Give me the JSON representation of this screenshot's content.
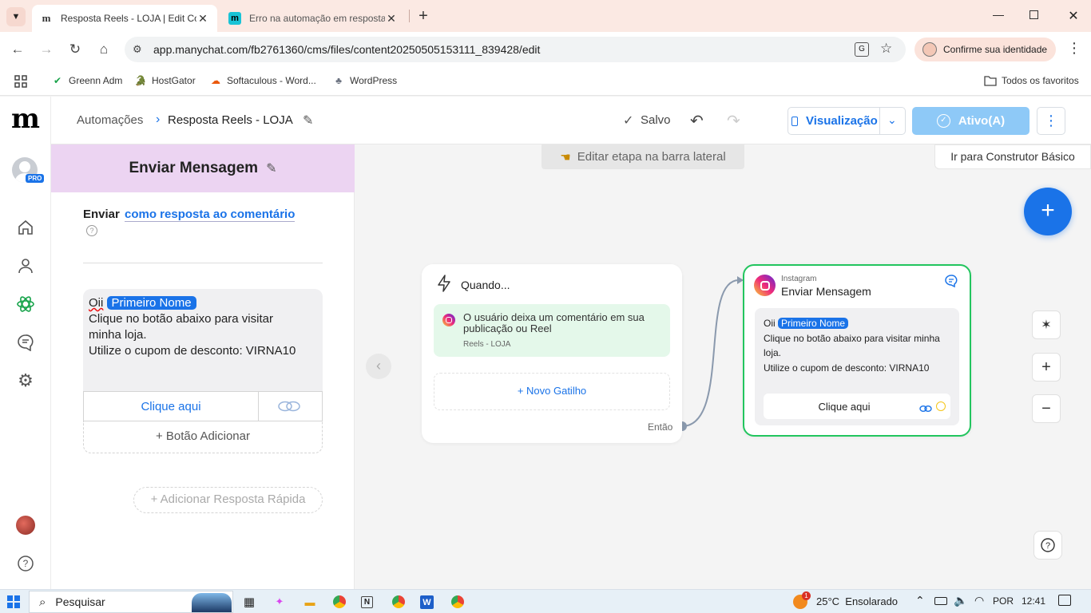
{
  "browser": {
    "tabs": [
      {
        "title": "Resposta Reels - LOJA | Edit Co",
        "active": true
      },
      {
        "title": "Erro na automação em resposta",
        "active": false
      }
    ],
    "url": "app.manychat.com/fb2761360/cms/files/content20250505153111_839428/edit",
    "profile_label": "Confirme sua identidade",
    "bookmarks": [
      "Greenn Adm",
      "HostGator",
      "Softaculous - Word...",
      "WordPress"
    ],
    "all_bookmarks": "Todos os favoritos"
  },
  "app": {
    "logo": "m",
    "pro_badge": "PRO",
    "breadcrumb": {
      "parent": "Automações",
      "current": "Resposta Reels - LOJA"
    },
    "saved": "Salvo",
    "preview_label": "Visualização",
    "active_label": "Ativo(A)",
    "basic_builder_label": "Ir para Construtor Básico",
    "hint_label": "Editar etapa na barra lateral"
  },
  "panel": {
    "title": "Enviar Mensagem",
    "send_prefix": "Enviar",
    "send_mode": "como resposta ao comentário",
    "message": {
      "greeting": "Oii",
      "first_name_tag": "Primeiro Nome",
      "line1": "Clique no botão abaixo para visitar",
      "line2": "minha loja.",
      "line3": "Utilize o cupom de desconto: VIRNA10"
    },
    "button_label": "Clique aqui",
    "add_button": "+ Botão Adicionar",
    "add_quick_reply": "+ Adicionar Resposta Rápida"
  },
  "trigger_card": {
    "title": "Quando...",
    "trigger_text": "O usuário deixa um comentário em sua publicação ou Reel",
    "trigger_sub": "Reels - LOJA",
    "new_trigger": "+ Novo Gatilho",
    "then_label": "Então"
  },
  "message_card": {
    "channel": "Instagram",
    "title": "Enviar Mensagem",
    "greeting": "Oii",
    "first_name_tag": "Primeiro Nome",
    "line1": "Clique no botão abaixo para visitar minha",
    "line2": "loja.",
    "line3": "Utilize o cupom de desconto: VIRNA10",
    "button_label": "Clique aqui"
  },
  "taskbar": {
    "search_placeholder": "Pesquisar",
    "weather": "25°C  Ensolarado",
    "weather_badge": "1",
    "language": "POR",
    "time": "12:41"
  },
  "colors": {
    "accent": "#1a73e8",
    "panel_header": "#ecd4f2",
    "trigger_bg": "#e4f8ea",
    "active_node_border": "#22c55e",
    "active_btn": "#8ec9f7"
  }
}
